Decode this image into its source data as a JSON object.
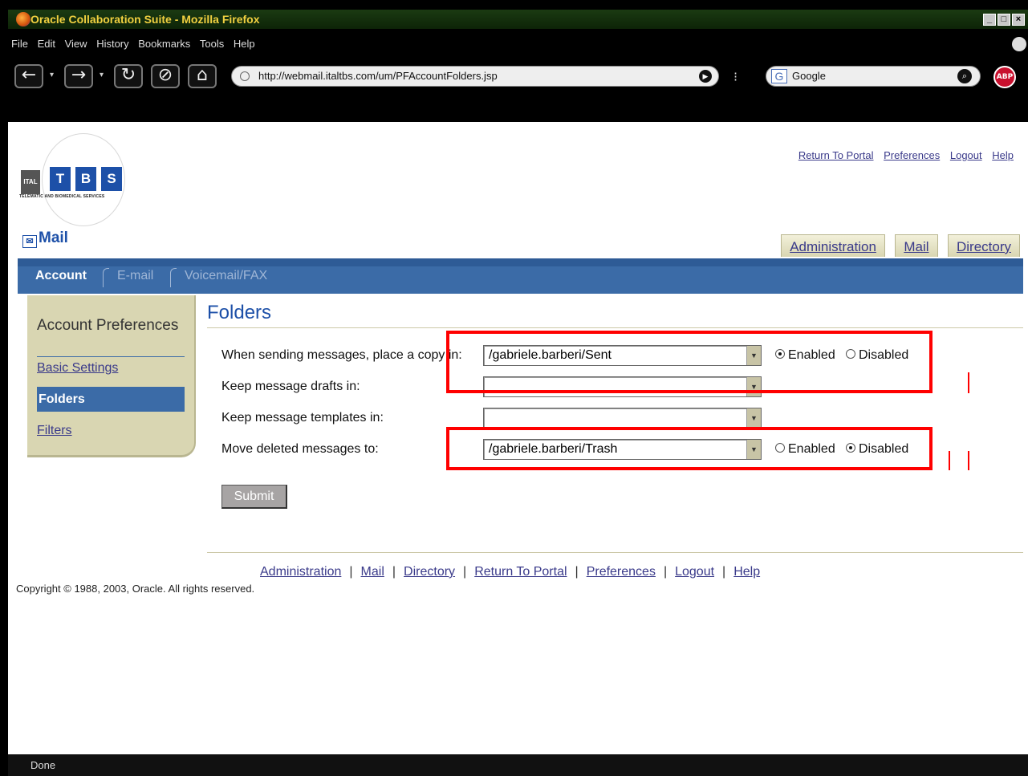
{
  "window": {
    "title": "Oracle Collaboration Suite - Mozilla Firefox"
  },
  "menu": [
    "File",
    "Edit",
    "View",
    "History",
    "Bookmarks",
    "Tools",
    "Help"
  ],
  "navbar": {
    "url": "http://webmail.italtbs.com/um/PFAccountFolders.jsp",
    "search_placeholder": "Google",
    "abp": "ABP"
  },
  "logo": {
    "ital": "ITAL",
    "letters": [
      "T",
      "B",
      "S"
    ],
    "subtitle": "TELEMATIC AND BIOMEDICAL SERVICES"
  },
  "app": {
    "title": "Mail"
  },
  "top_links": [
    "Return To Portal",
    "Preferences",
    "Logout",
    "Help"
  ],
  "global_tabs": [
    "Administration",
    "Mail",
    "Directory"
  ],
  "sub_tabs": {
    "active": "Account",
    "inactive": [
      "E-mail",
      "Voicemail/FAX"
    ]
  },
  "sidenav": {
    "header": "Account Preferences",
    "items": [
      "Basic Settings",
      "Folders",
      "Filters"
    ],
    "selected": "Folders"
  },
  "content": {
    "title": "Folders",
    "rows": [
      {
        "label": "When sending messages, place a copy in:",
        "value": "/gabriele.barberi/Sent",
        "radio": "Enabled"
      },
      {
        "label": "Keep message drafts in:",
        "value": ""
      },
      {
        "label": "Keep message templates in:",
        "value": ""
      },
      {
        "label": "Move deleted messages to:",
        "value": "/gabriele.barberi/Trash",
        "radio": "Disabled"
      }
    ],
    "radio_labels": [
      "Enabled",
      "Disabled"
    ],
    "submit": "Submit"
  },
  "footer": {
    "links": [
      "Administration",
      "Mail",
      "Directory",
      "Return To Portal",
      "Preferences",
      "Logout",
      "Help"
    ],
    "copyright": "Copyright © 1988, 2003, Oracle. All rights reserved."
  },
  "status": "Done",
  "colors": {
    "accent_blue": "#3b6ba7",
    "panel_tan": "#d9d6b2",
    "annotation_red": "#ff0000"
  }
}
